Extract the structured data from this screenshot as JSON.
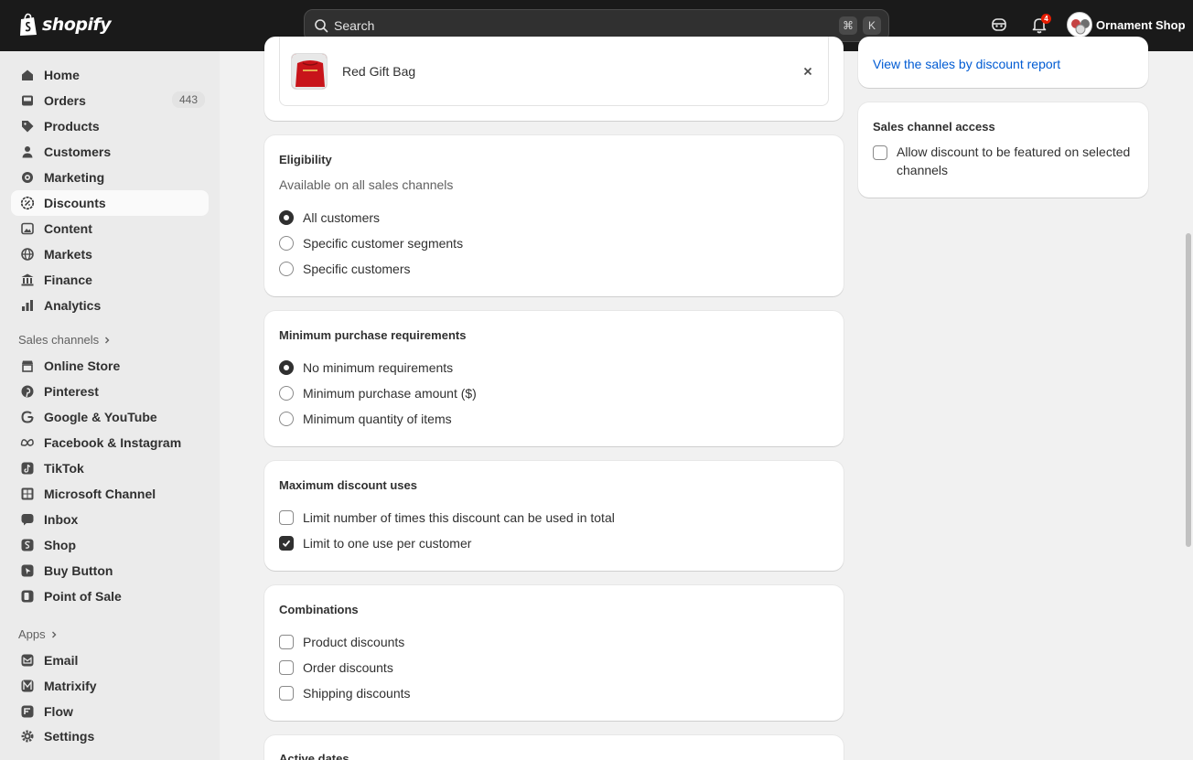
{
  "topbar": {
    "brand": "shopify",
    "search_placeholder": "Search",
    "shortcut_cmd": "⌘",
    "shortcut_key": "K",
    "notification_count": "4",
    "store_name": "Ornament Shop"
  },
  "sidebar": {
    "main_items": [
      {
        "label": "Home"
      },
      {
        "label": "Orders",
        "count": "443"
      },
      {
        "label": "Products"
      },
      {
        "label": "Customers"
      },
      {
        "label": "Marketing"
      },
      {
        "label": "Discounts"
      },
      {
        "label": "Content"
      },
      {
        "label": "Markets"
      },
      {
        "label": "Finance"
      },
      {
        "label": "Analytics"
      }
    ],
    "sales_channels_heading": "Sales channels",
    "sales_channels": [
      {
        "label": "Online Store"
      },
      {
        "label": "Pinterest"
      },
      {
        "label": "Google & YouTube"
      },
      {
        "label": "Facebook & Instagram"
      },
      {
        "label": "TikTok"
      },
      {
        "label": "Microsoft Channel"
      },
      {
        "label": "Inbox"
      },
      {
        "label": "Shop"
      },
      {
        "label": "Buy Button"
      },
      {
        "label": "Point of Sale"
      }
    ],
    "apps_heading": "Apps",
    "apps": [
      {
        "label": "Email"
      },
      {
        "label": "Matrixify"
      },
      {
        "label": "Flow"
      }
    ],
    "settings_label": "Settings"
  },
  "main": {
    "product": {
      "name": "Red Gift Bag"
    },
    "eligibility": {
      "title": "Eligibility",
      "subtitle": "Available on all sales channels",
      "options": [
        "All customers",
        "Specific customer segments",
        "Specific customers"
      ]
    },
    "min_purchase": {
      "title": "Minimum purchase requirements",
      "options": [
        "No minimum requirements",
        "Minimum purchase amount ($)",
        "Minimum quantity of items"
      ]
    },
    "max_uses": {
      "title": "Maximum discount uses",
      "options": [
        "Limit number of times this discount can be used in total",
        "Limit to one use per customer"
      ]
    },
    "combinations": {
      "title": "Combinations",
      "options": [
        "Product discounts",
        "Order discounts",
        "Shipping discounts"
      ]
    },
    "active_dates": {
      "title": "Active dates"
    }
  },
  "aside": {
    "report_link": "View the sales by discount report",
    "sales_channel_access": {
      "title": "Sales channel access",
      "checkbox_line1": "Allow discount to be featured on selected",
      "checkbox_line2": "channels"
    }
  }
}
